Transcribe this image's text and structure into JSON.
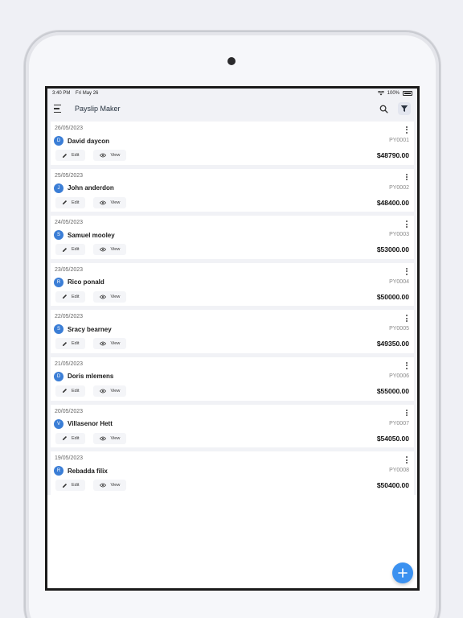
{
  "statusbar": {
    "time": "3:40 PM",
    "date": "Fri May 26",
    "battery": "100%"
  },
  "appbar": {
    "title": "Payslip Maker"
  },
  "icons": {
    "menu": "menu-icon",
    "search": "search-icon",
    "filter": "filter-icon",
    "more": "more-vert-icon",
    "edit": "pencil-icon",
    "view": "eye-icon",
    "add": "plus-icon"
  },
  "colors": {
    "accent": "#3b91f0",
    "avatar": "#3b7ed6"
  },
  "actions": {
    "edit_label": "Edit",
    "view_label": "View"
  },
  "payslips": [
    {
      "date": "26/05/2023",
      "initial": "D",
      "name": "David daycon",
      "code": "PY0001",
      "amount": "$48790.00"
    },
    {
      "date": "25/05/2023",
      "initial": "J",
      "name": "John anderdon",
      "code": "PY0002",
      "amount": "$48400.00"
    },
    {
      "date": "24/05/2023",
      "initial": "S",
      "name": "Samuel mooley",
      "code": "PY0003",
      "amount": "$53000.00"
    },
    {
      "date": "23/05/2023",
      "initial": "R",
      "name": "Rico ponald",
      "code": "PY0004",
      "amount": "$50000.00"
    },
    {
      "date": "22/05/2023",
      "initial": "S",
      "name": "Sracy bearney",
      "code": "PY0005",
      "amount": "$49350.00"
    },
    {
      "date": "21/05/2023",
      "initial": "D",
      "name": "Doris mlemens",
      "code": "PY0006",
      "amount": "$55000.00"
    },
    {
      "date": "20/05/2023",
      "initial": "V",
      "name": "Villasenor Hett",
      "code": "PY0007",
      "amount": "$54050.00"
    },
    {
      "date": "19/05/2023",
      "initial": "R",
      "name": "Rebadda filix",
      "code": "PY0008",
      "amount": "$50400.00"
    }
  ]
}
